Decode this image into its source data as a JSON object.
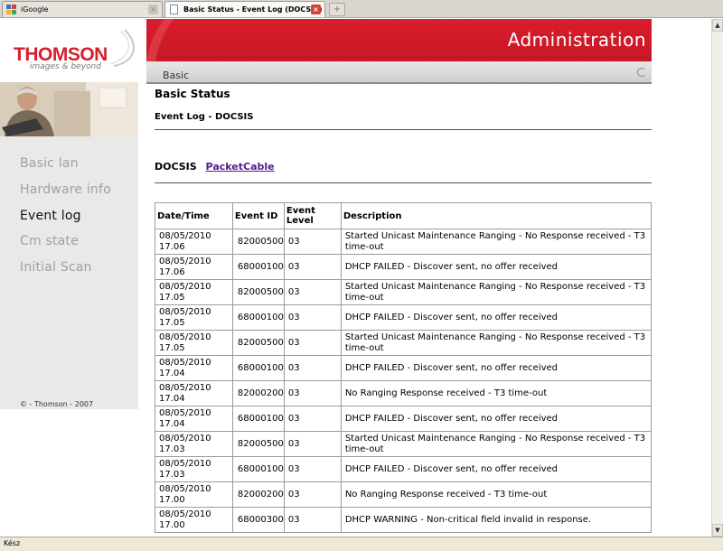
{
  "browser": {
    "tabs": [
      {
        "label": "iGoogle",
        "active": false
      },
      {
        "label": "Basic Status - Event Log (DOCSIS)",
        "active": true
      }
    ],
    "new_tab_label": "+",
    "status_text": "Kész"
  },
  "brand": {
    "logo_text": "THOMSON",
    "tagline": "images & beyond",
    "accent_color": "#d91d2c",
    "copyright": "© - Thomson - 2007"
  },
  "header": {
    "title": "Administration",
    "section": "Basic"
  },
  "sidebar": {
    "items": [
      {
        "label": "Basic lan",
        "active": false
      },
      {
        "label": "Hardware info",
        "active": false
      },
      {
        "label": "Event log",
        "active": true
      },
      {
        "label": "Cm state",
        "active": false
      },
      {
        "label": "Initial Scan",
        "active": false
      }
    ]
  },
  "page": {
    "title": "Basic Status",
    "subtitle": "Event Log - DOCSIS",
    "mode_current": "DOCSIS",
    "mode_link": "PacketCable"
  },
  "table": {
    "headers": [
      "Date/Time",
      "Event ID",
      "Event Level",
      "Description"
    ],
    "rows": [
      {
        "date": "08/05/2010",
        "time": "17.06",
        "id": "82000500",
        "level": "03",
        "desc": "Started Unicast Maintenance Ranging - No Response received - T3 time-out"
      },
      {
        "date": "08/05/2010",
        "time": "17.06",
        "id": "68000100",
        "level": "03",
        "desc": "DHCP FAILED - Discover sent, no offer received"
      },
      {
        "date": "08/05/2010",
        "time": "17.05",
        "id": "82000500",
        "level": "03",
        "desc": "Started Unicast Maintenance Ranging - No Response received - T3 time-out"
      },
      {
        "date": "08/05/2010",
        "time": "17.05",
        "id": "68000100",
        "level": "03",
        "desc": "DHCP FAILED - Discover sent, no offer received"
      },
      {
        "date": "08/05/2010",
        "time": "17.05",
        "id": "82000500",
        "level": "03",
        "desc": "Started Unicast Maintenance Ranging - No Response received - T3 time-out"
      },
      {
        "date": "08/05/2010",
        "time": "17.04",
        "id": "68000100",
        "level": "03",
        "desc": "DHCP FAILED - Discover sent, no offer received"
      },
      {
        "date": "08/05/2010",
        "time": "17.04",
        "id": "82000200",
        "level": "03",
        "desc": "No Ranging Response received - T3 time-out"
      },
      {
        "date": "08/05/2010",
        "time": "17.04",
        "id": "68000100",
        "level": "03",
        "desc": "DHCP FAILED - Discover sent, no offer received"
      },
      {
        "date": "08/05/2010",
        "time": "17.03",
        "id": "82000500",
        "level": "03",
        "desc": "Started Unicast Maintenance Ranging - No Response received - T3 time-out"
      },
      {
        "date": "08/05/2010",
        "time": "17.03",
        "id": "68000100",
        "level": "03",
        "desc": "DHCP FAILED - Discover sent, no offer received"
      },
      {
        "date": "08/05/2010",
        "time": "17.00",
        "id": "82000200",
        "level": "03",
        "desc": "No Ranging Response received - T3 time-out"
      },
      {
        "date": "08/05/2010",
        "time": "17.00",
        "id": "68000300",
        "level": "03",
        "desc": "DHCP WARNING - Non-critical field invalid in response."
      }
    ]
  }
}
